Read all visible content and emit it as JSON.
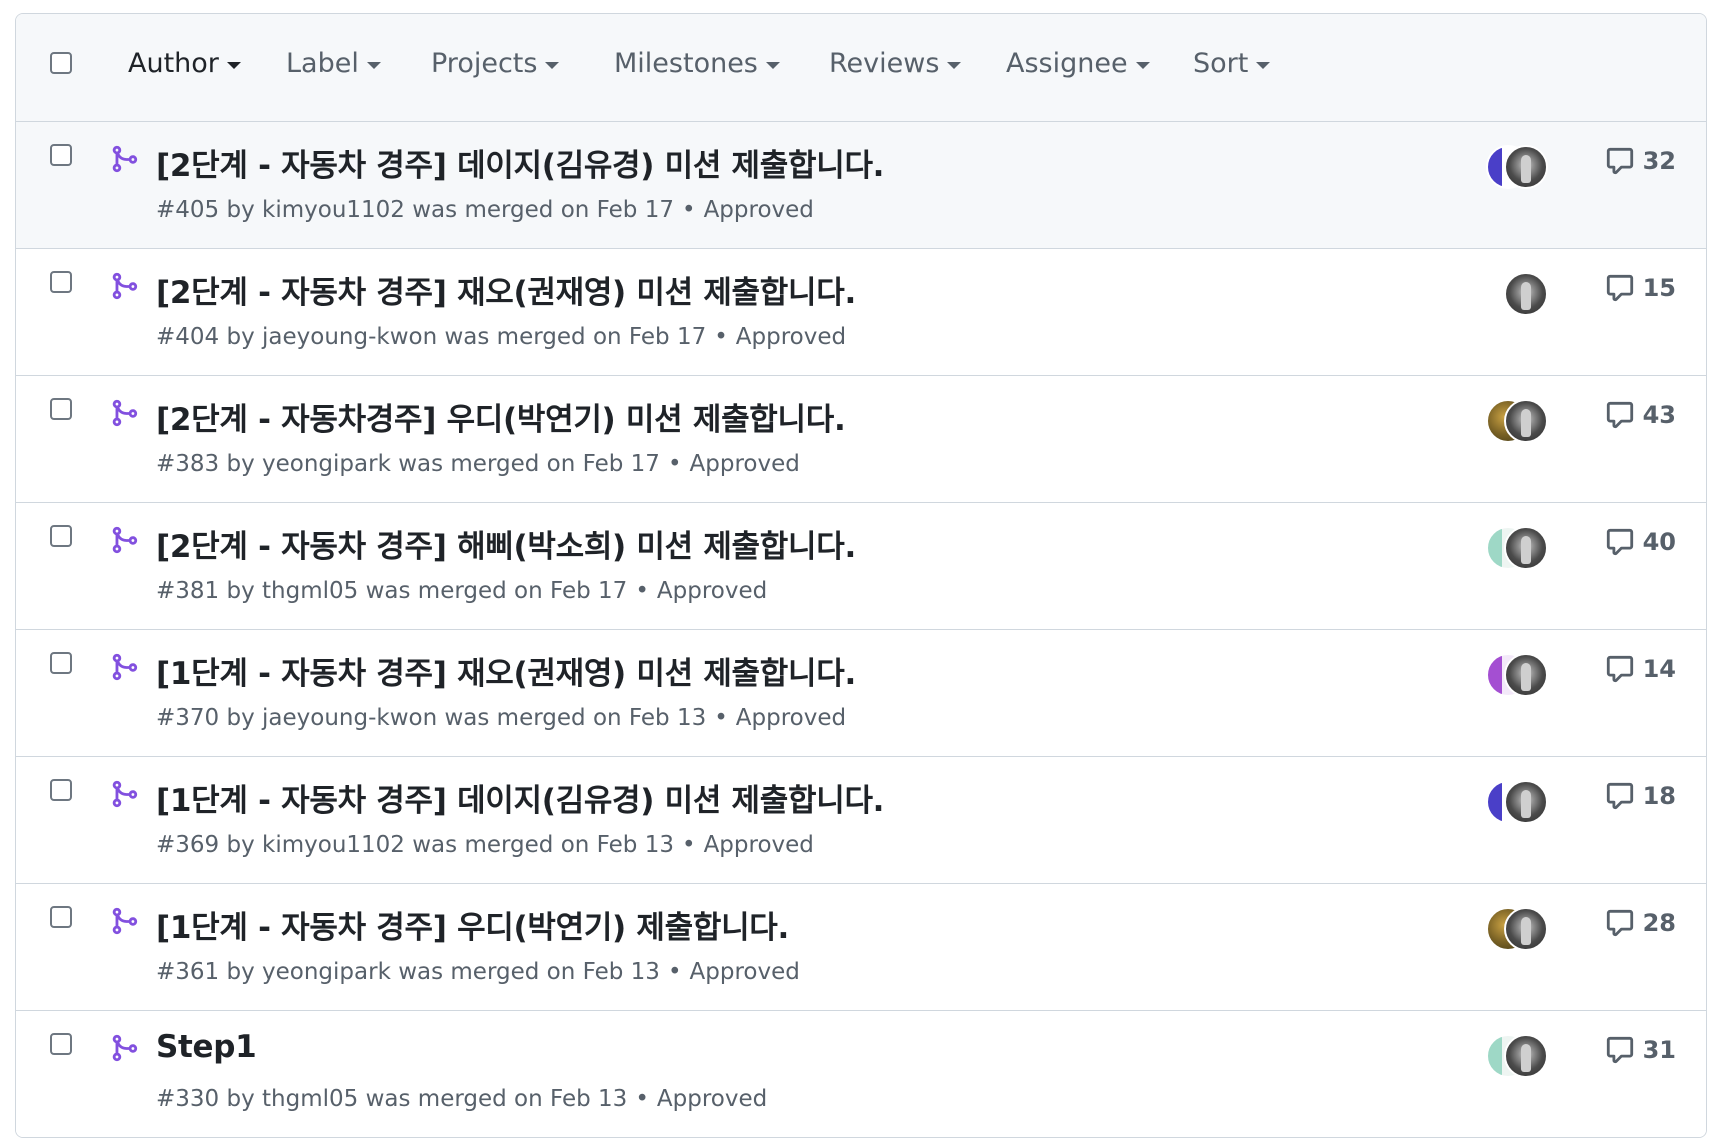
{
  "filters": [
    {
      "label": "Author"
    },
    {
      "label": "Label"
    },
    {
      "label": "Projects"
    },
    {
      "label": "Milestones"
    },
    {
      "label": "Reviews"
    },
    {
      "label": "Assignee"
    },
    {
      "label": "Sort"
    }
  ],
  "colors": {
    "merged_icon": "#8250df",
    "muted_text": "#57606a",
    "border": "#d0d7de",
    "header_bg": "#f6f8fa"
  },
  "pull_requests": [
    {
      "title": "[2단계 - 자동차 경주] 데이지(김유경) 미션 제출합니다.",
      "number": "#405",
      "by": "by",
      "author": "kimyou1102",
      "merged_text": "was merged on Feb 17",
      "dot": "•",
      "review": "Approved",
      "comments": "32",
      "avatars": [
        "av-blue",
        "av-photo"
      ],
      "icon": "git-merge-icon"
    },
    {
      "title": "[2단계 - 자동차 경주] 재오(권재영) 미션 제출합니다.",
      "number": "#404",
      "by": "by",
      "author": "jaeyoung-kwon",
      "merged_text": "was merged on Feb 17",
      "dot": "•",
      "review": "Approved",
      "comments": "15",
      "avatars": [
        "av-photo"
      ],
      "icon": "git-merge-icon"
    },
    {
      "title": "[2단계 - 자동차경주] 우디(박연기) 미션 제출합니다.",
      "number": "#383",
      "by": "by",
      "author": "yeongipark",
      "merged_text": "was merged on Feb 17",
      "dot": "•",
      "review": "Approved",
      "comments": "43",
      "avatars": [
        "av-autumn",
        "av-photo"
      ],
      "icon": "git-merge-icon"
    },
    {
      "title": "[2단계 - 자동차 경주] 해삐(박소희) 미션 제출합니다.",
      "number": "#381",
      "by": "by",
      "author": "thgml05",
      "merged_text": "was merged on Feb 17",
      "dot": "•",
      "review": "Approved",
      "comments": "40",
      "avatars": [
        "av-mint",
        "av-photo"
      ],
      "icon": "git-merge-icon"
    },
    {
      "title": "[1단계 - 자동차 경주] 재오(권재영) 미션 제출합니다.",
      "number": "#370",
      "by": "by",
      "author": "jaeyoung-kwon",
      "merged_text": "was merged on Feb 13",
      "dot": "•",
      "review": "Approved",
      "comments": "14",
      "avatars": [
        "av-purple",
        "av-photo"
      ],
      "icon": "git-merge-icon"
    },
    {
      "title": "[1단계 - 자동차 경주] 데이지(김유경) 미션 제출합니다.",
      "number": "#369",
      "by": "by",
      "author": "kimyou1102",
      "merged_text": "was merged on Feb 13",
      "dot": "•",
      "review": "Approved",
      "comments": "18",
      "avatars": [
        "av-blue",
        "av-photo"
      ],
      "icon": "git-merge-icon"
    },
    {
      "title": "[1단계 - 자동차 경주] 우디(박연기) 제출합니다.",
      "number": "#361",
      "by": "by",
      "author": "yeongipark",
      "merged_text": "was merged on Feb 13",
      "dot": "•",
      "review": "Approved",
      "comments": "28",
      "avatars": [
        "av-autumn",
        "av-photo"
      ],
      "icon": "git-merge-icon"
    },
    {
      "title": "Step1",
      "number": "#330",
      "by": "by",
      "author": "thgml05",
      "merged_text": "was merged on Feb 13",
      "dot": "•",
      "review": "Approved",
      "comments": "31",
      "avatars": [
        "av-mint",
        "av-photo"
      ],
      "icon": "git-merge-icon"
    }
  ]
}
